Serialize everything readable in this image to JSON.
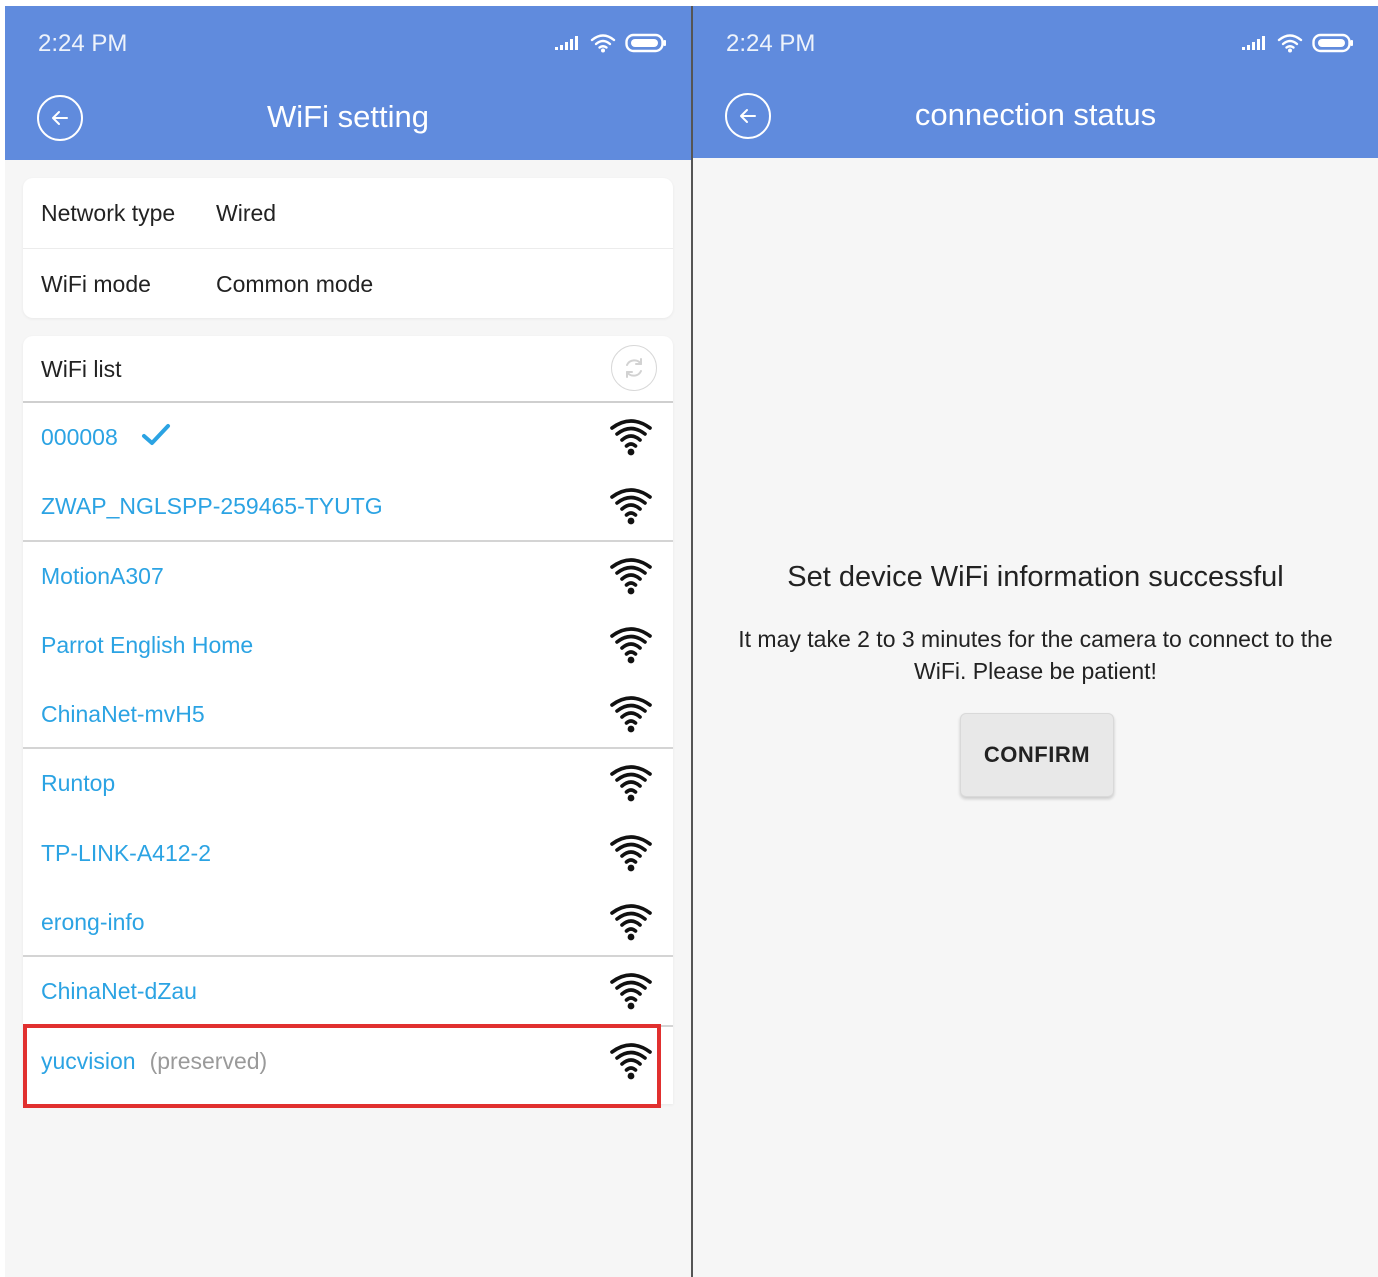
{
  "colors": {
    "header": "#608bdd",
    "link": "#2ba3e3",
    "highlight": "#e1302f",
    "background": "#f6f6f6"
  },
  "left_screen": {
    "status_bar": {
      "time": "2:24 PM",
      "icons": [
        "signal-icon",
        "wifi-status-icon",
        "battery-icon"
      ]
    },
    "title": "WiFi setting",
    "network": {
      "type_label": "Network type",
      "type_value": "Wired",
      "mode_label": "WiFi mode",
      "mode_value": "Common mode"
    },
    "wifi_list": {
      "header": "WiFi list",
      "items": [
        {
          "ssid": "000008",
          "connected": true
        },
        {
          "ssid": "ZWAP_NGLSPP-259465-TYUTG"
        },
        {
          "ssid": "MotionA307"
        },
        {
          "ssid": "Parrot English Home"
        },
        {
          "ssid": "ChinaNet-mvH5"
        },
        {
          "ssid": "Runtop"
        },
        {
          "ssid": "TP-LINK-A412-2"
        },
        {
          "ssid": "erong-info"
        },
        {
          "ssid": "ChinaNet-dZau"
        },
        {
          "ssid": "yucvision",
          "note": "(preserved)",
          "highlighted": true
        }
      ]
    }
  },
  "right_screen": {
    "status_bar": {
      "time": "2:24 PM",
      "icons": [
        "signal-icon",
        "wifi-status-icon",
        "battery-icon"
      ]
    },
    "title": "connection status",
    "message_title": "Set device WiFi information successful",
    "message_body": "It may take 2 to 3 minutes for the camera to connect to the WiFi. Please be patient!",
    "confirm_label": "CONFIRM"
  }
}
